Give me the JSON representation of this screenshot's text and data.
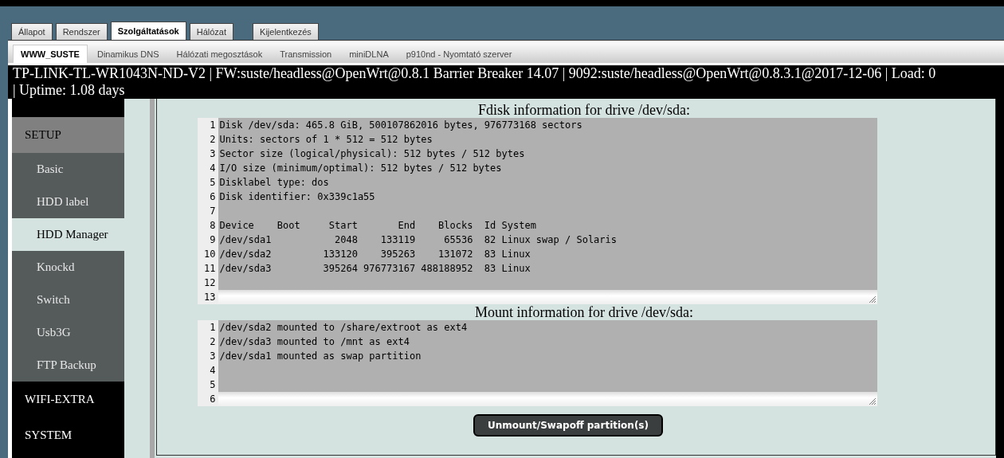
{
  "main_tabs": [
    {
      "label": "Állapot",
      "selected": false
    },
    {
      "label": "Rendszer",
      "selected": false
    },
    {
      "label": "Szolgáltatások",
      "selected": true
    },
    {
      "label": "Hálózat",
      "selected": false
    },
    {
      "label": "Kijelentkezés",
      "selected": false,
      "kind": "logout"
    }
  ],
  "sub_tabs": [
    {
      "label": "WWW_SUSTE",
      "selected": true
    },
    {
      "label": "Dinamikus DNS",
      "selected": false
    },
    {
      "label": "Hálózati megosztások",
      "selected": false
    },
    {
      "label": "Transmission",
      "selected": false
    },
    {
      "label": "miniDLNA",
      "selected": false
    },
    {
      "label": "p910nd - Nyomtató szerver",
      "selected": false
    }
  ],
  "header": {
    "line1": "TP-LINK-TL-WR1043N-ND-V2 | FW:suste/headless@OpenWrt@0.8.1 Barrier Breaker 14.07 | 9092:suste/headless@OpenWrt@0.8.3.1@2017-12-06 | Load: 0",
    "line2": "| Uptime: 1.08 days"
  },
  "sidebar": {
    "items": [
      {
        "label": "SETUP",
        "kind": "section",
        "selected": true,
        "children": [
          {
            "label": "Basic",
            "selected": false
          },
          {
            "label": "HDD label",
            "selected": false
          },
          {
            "label": "HDD Manager",
            "selected": true
          },
          {
            "label": "Knockd",
            "selected": false
          },
          {
            "label": "Switch",
            "selected": false
          },
          {
            "label": "Usb3G",
            "selected": false
          },
          {
            "label": "FTP Backup",
            "selected": false
          }
        ]
      },
      {
        "label": "WIFI-EXTRA",
        "kind": "section",
        "selected": false
      },
      {
        "label": "SYSTEM",
        "kind": "section",
        "selected": false
      }
    ]
  },
  "fdisk": {
    "title": "Fdisk information for drive /dev/sda:",
    "lines": [
      {
        "number": "1",
        "text": "Disk /dev/sda: 465.8 GiB, 500107862016 bytes, 976773168 sectors"
      },
      {
        "number": "2",
        "text": "Units: sectors of 1 * 512 = 512 bytes"
      },
      {
        "number": "3",
        "text": "Sector size (logical/physical): 512 bytes / 512 bytes"
      },
      {
        "number": "4",
        "text": "I/O size (minimum/optimal): 512 bytes / 512 bytes"
      },
      {
        "number": "5",
        "text": "Disklabel type: dos"
      },
      {
        "number": "6",
        "text": "Disk identifier: 0x339c1a55"
      },
      {
        "number": "7"
      },
      {
        "number": "8",
        "text": "Device    Boot     Start       End    Blocks  Id System"
      },
      {
        "number": "9",
        "text": "/dev/sda1           2048    133119     65536  82 Linux swap / Solaris"
      },
      {
        "number": "10",
        "text": "/dev/sda2         133120    395263    131072  83 Linux"
      },
      {
        "number": "11",
        "text": "/dev/sda3         395264 976773167 488188952  83 Linux"
      },
      {
        "number": "12"
      },
      {
        "number": "13"
      }
    ]
  },
  "mount": {
    "title": "Mount information for drive /dev/sda:",
    "lines": [
      {
        "number": "1",
        "text": "/dev/sda2 mounted to /share/extroot as ext4"
      },
      {
        "number": "2",
        "text": "/dev/sda3 mounted to /mnt as ext4"
      },
      {
        "number": "3",
        "text": "/dev/sda1 mounted as swap partition"
      },
      {
        "number": "4"
      },
      {
        "number": "5"
      },
      {
        "number": "6"
      }
    ]
  },
  "button": {
    "label": "Unmount/Swapoff partition(s)"
  }
}
